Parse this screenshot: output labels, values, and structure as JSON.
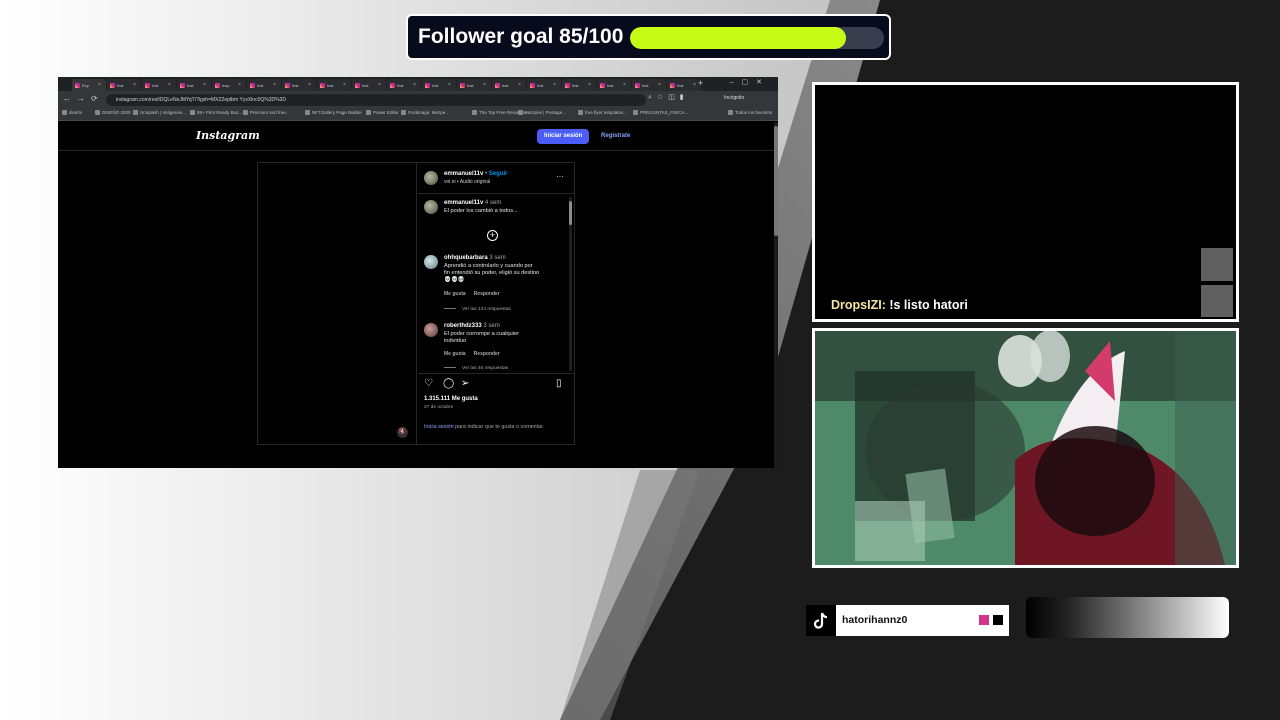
{
  "overlay": {
    "goal": {
      "label": "Follower goal 85/100",
      "current": 85,
      "target": 100,
      "progress_fraction": 0.85,
      "fill_color": "#c6fb16"
    },
    "chat": {
      "username": "DropsIZI:",
      "message": "!s listo hatori",
      "username_color": "#f5e3a5"
    },
    "tiktok": {
      "icon": "tiktok-icon",
      "handle": "hatorihannz0",
      "accent_colors": [
        "#d0358c",
        "#000000"
      ]
    }
  },
  "browser": {
    "tabs": [
      {
        "label": "Exp"
      },
      {
        "label": "Inst"
      },
      {
        "label": "Inst"
      },
      {
        "label": "Inst"
      },
      {
        "label": "Insp"
      },
      {
        "label": "Inst"
      },
      {
        "label": "Inst"
      },
      {
        "label": "Inst"
      },
      {
        "label": "Inst"
      },
      {
        "label": "Inst"
      },
      {
        "label": "Inst"
      },
      {
        "label": "Inst"
      },
      {
        "label": "Inst"
      },
      {
        "label": "Inst"
      },
      {
        "label": "Inst"
      },
      {
        "label": "Inst"
      },
      {
        "label": "Inst"
      },
      {
        "label": "Inst"
      }
    ],
    "url": "instagram.com/reel/DQLeNeJMYqT/?igsh=MXZ2eptbm YysXlnc0Q%3D%3D",
    "incognito_label": "Incógnito",
    "bookmarks": [
      "diseño",
      "DISEÑO 2000",
      "Unsplash | Imágenes...",
      "85+ Print Ready Bus...",
      "Premium and free...",
      "NFTGallery Page Builder",
      "Power Editor",
      "Postimage: Mezpe...",
      "The Top Free Resource...",
      "Mezpine | Postage...",
      "free flyer templates...",
      "PREGUNTAS_FISICA...",
      "Todos los favoritos"
    ]
  },
  "instagram": {
    "logo": "Instagram",
    "login_button": "Iniciar sesión",
    "register_link": "Regístrate",
    "post": {
      "author": "emmanuel11v",
      "follow": "Seguir",
      "audio": "vol.ei • Audio original",
      "caption_author": "emmanuel11v",
      "caption_time": "4 sem",
      "caption_text": "El poder los cambió a todos...",
      "comments": [
        {
          "user": "ohhquebarbara",
          "time": "3 sem",
          "text_lines": [
            "Aprendió a controlarlo y cuando por",
            "fin entendió su poder, eligió su destino",
            "💀💀💀"
          ],
          "like_label": "Me gusta",
          "reply_label": "Responder",
          "replies_label": "Ver las 134 respuestas"
        },
        {
          "user": "roberthdz333",
          "time": "3 sem",
          "text_lines": [
            "El poder corrompe a cualquier",
            "individuo"
          ],
          "like_label": "Me gusta",
          "reply_label": "Responder",
          "replies_label": "Ver las 46 respuestas"
        }
      ],
      "likes": "1.315.111 Me gusta",
      "date": "27 de octubre",
      "login_hint_link": "Inicia sesión",
      "login_hint_rest": "para indicar que te gusta o comentar."
    }
  },
  "icons": [
    "back-icon",
    "forward-icon",
    "reload-icon",
    "heart-icon",
    "comment-icon",
    "share-icon",
    "bookmark-icon",
    "mute-icon",
    "more-icon",
    "add-comment-icon"
  ]
}
